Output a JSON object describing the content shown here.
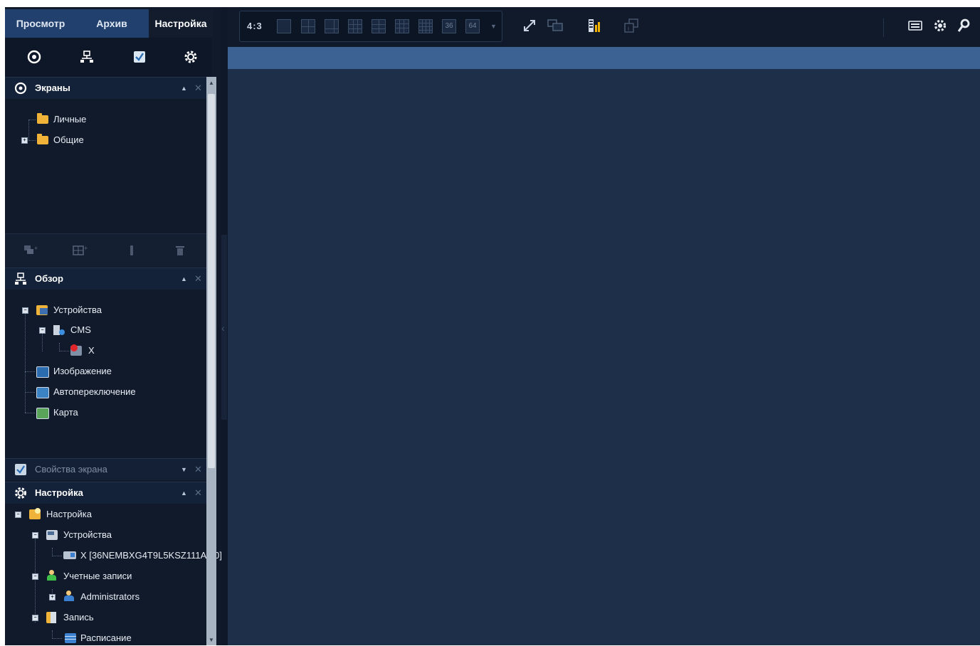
{
  "tabs": [
    {
      "label": "Просмотр",
      "active": false
    },
    {
      "label": "Архив",
      "active": false
    },
    {
      "label": "Настройка",
      "active": true
    }
  ],
  "icon_bar": [
    "screens-icon",
    "devices-icon",
    "screen-properties-icon",
    "settings-gear-icon"
  ],
  "screens_panel": {
    "title": "Экраны",
    "items": [
      {
        "label": "Личные",
        "icon": "folder-icon"
      },
      {
        "label": "Общие",
        "icon": "folder-icon",
        "expandable": true
      }
    ],
    "tools": [
      "add-screen-icon",
      "add-grid-icon",
      "delete-icon",
      "trash-icon"
    ]
  },
  "overview_panel": {
    "title": "Обзор",
    "items": [
      {
        "label": "Устройства",
        "icon": "devices-folder-icon"
      },
      {
        "label": "CMS",
        "icon": "cms-server-icon"
      },
      {
        "label": "X",
        "icon": "offline-camera-icon"
      },
      {
        "label": "Изображение",
        "icon": "image-icon"
      },
      {
        "label": "Автопереключение",
        "icon": "autoswitch-icon"
      },
      {
        "label": "Карта",
        "icon": "map-icon"
      }
    ]
  },
  "screen_props_panel": {
    "title": "Свойства экрана"
  },
  "settings_panel": {
    "title": "Настройка",
    "items": [
      {
        "label": "Настройка",
        "icon": "settings-folder-icon"
      },
      {
        "label": "Устройства",
        "icon": "devices-icon"
      },
      {
        "label": "X [36NEMBXG4T9L5KSZ111A:80]",
        "icon": "device-icon"
      },
      {
        "label": "Учетные записи",
        "icon": "accounts-icon"
      },
      {
        "label": "Administrators",
        "icon": "user-group-icon"
      },
      {
        "label": "Запись",
        "icon": "record-icon"
      },
      {
        "label": "Расписание",
        "icon": "schedule-icon"
      }
    ]
  },
  "toolbar": {
    "aspect_ratio": "4:3",
    "grid_layouts": [
      "1",
      "4",
      "6",
      "9",
      "10",
      "13",
      "16",
      "36",
      "64"
    ],
    "grid_36": "36",
    "grid_64": "64",
    "icons": [
      "fullscreen-icon",
      "screen-switch-icon",
      "stream-bars-icon",
      "info-window-icon"
    ],
    "right_icons": [
      "keyboard-icon",
      "gear-icon",
      "search-icon"
    ]
  },
  "colors": {
    "main_background": "#1e2f4a",
    "active_strip": "#3c6193",
    "tab_bar": "#22406d",
    "panel_background": "#101a2b"
  }
}
